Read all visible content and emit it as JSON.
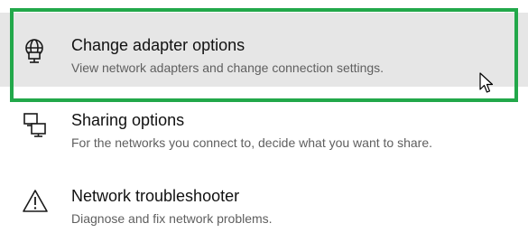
{
  "items": [
    {
      "title": "Change adapter options",
      "description": "View network adapters and change connection settings.",
      "icon": "network-adapter-icon",
      "hovered": true
    },
    {
      "title": "Sharing options",
      "description": "For the networks you connect to, decide what you want to share.",
      "icon": "sharing-computers-icon",
      "hovered": false
    },
    {
      "title": "Network troubleshooter",
      "description": "Diagnose and fix network problems.",
      "icon": "warning-triangle-icon",
      "hovered": false
    }
  ],
  "colors": {
    "highlight_border": "#22a84a",
    "hover_background": "#e6e6e6",
    "title_text": "#111111",
    "description_text": "#5f5f5f"
  }
}
